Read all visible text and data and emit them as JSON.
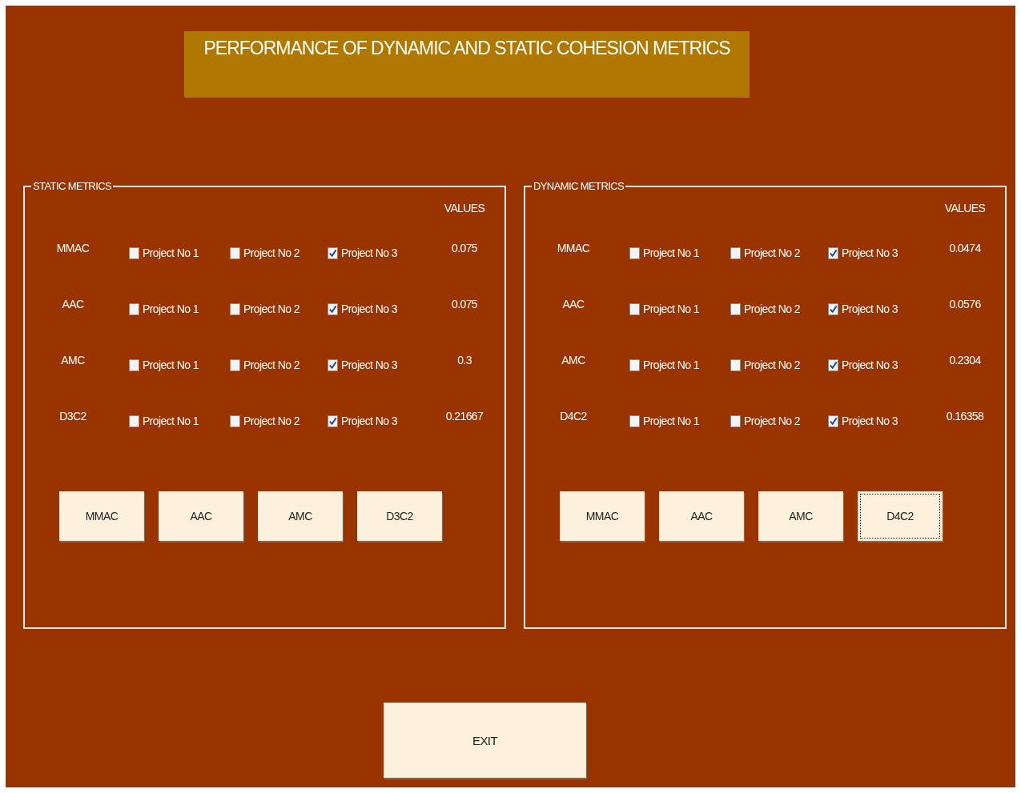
{
  "title": "PERFORMANCE OF DYNAMIC AND STATIC COHESION METRICS",
  "panels": [
    {
      "title": "STATIC METRICS",
      "values_header": "VALUES",
      "rows": [
        {
          "metric": "MMAC",
          "projects": [
            {
              "label": "Project No 1",
              "checked": false
            },
            {
              "label": "Project No 2",
              "checked": false
            },
            {
              "label": "Project No 3",
              "checked": true
            }
          ],
          "value": "0.075"
        },
        {
          "metric": "AAC",
          "projects": [
            {
              "label": "Project No 1",
              "checked": false
            },
            {
              "label": "Project No 2",
              "checked": false
            },
            {
              "label": "Project No 3",
              "checked": true
            }
          ],
          "value": "0.075"
        },
        {
          "metric": "AMC",
          "projects": [
            {
              "label": "Project No 1",
              "checked": false
            },
            {
              "label": "Project No 2",
              "checked": false
            },
            {
              "label": "Project No 3",
              "checked": true
            }
          ],
          "value": "0.3"
        },
        {
          "metric": "D3C2",
          "projects": [
            {
              "label": "Project No 1",
              "checked": false
            },
            {
              "label": "Project No 2",
              "checked": false
            },
            {
              "label": "Project No 3",
              "checked": true
            }
          ],
          "value": "0.21667"
        }
      ],
      "buttons": [
        {
          "label": "MMAC",
          "focused": false
        },
        {
          "label": "AAC",
          "focused": false
        },
        {
          "label": "AMC",
          "focused": false
        },
        {
          "label": "D3C2",
          "focused": false
        }
      ]
    },
    {
      "title": "DYNAMIC METRICS",
      "values_header": "VALUES",
      "rows": [
        {
          "metric": "MMAC",
          "projects": [
            {
              "label": "Project No 1",
              "checked": false
            },
            {
              "label": "Project No 2",
              "checked": false
            },
            {
              "label": "Project No 3",
              "checked": true
            }
          ],
          "value": "0.0474"
        },
        {
          "metric": "AAC",
          "projects": [
            {
              "label": "Project No 1",
              "checked": false
            },
            {
              "label": "Project No 2",
              "checked": false
            },
            {
              "label": "Project No 3",
              "checked": true
            }
          ],
          "value": "0.0576"
        },
        {
          "metric": "AMC",
          "projects": [
            {
              "label": "Project No 1",
              "checked": false
            },
            {
              "label": "Project No 2",
              "checked": false
            },
            {
              "label": "Project No 3",
              "checked": true
            }
          ],
          "value": "0.2304"
        },
        {
          "metric": "D4C2",
          "projects": [
            {
              "label": "Project No 1",
              "checked": false
            },
            {
              "label": "Project No 2",
              "checked": false
            },
            {
              "label": "Project No 3",
              "checked": true
            }
          ],
          "value": "0.16358"
        }
      ],
      "buttons": [
        {
          "label": "MMAC",
          "focused": false
        },
        {
          "label": "AAC",
          "focused": false
        },
        {
          "label": "AMC",
          "focused": false
        },
        {
          "label": "D4C2",
          "focused": true
        }
      ]
    }
  ],
  "exit_button": "EXIT"
}
